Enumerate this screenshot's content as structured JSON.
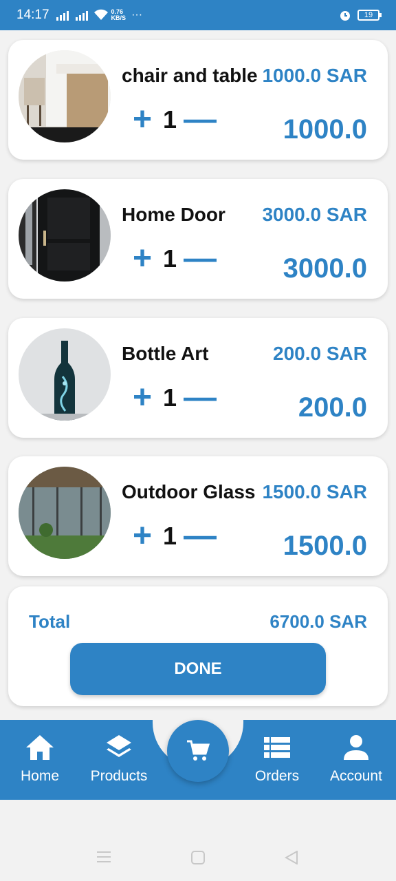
{
  "status_bar": {
    "time": "14:17",
    "speed_value": "0.76",
    "speed_unit": "KB/S",
    "more": "···",
    "battery": "19"
  },
  "cart": {
    "items": [
      {
        "name": "chair and table",
        "price": "1000.0 SAR",
        "quantity": "1",
        "line_total": "1000.0",
        "image_icon": "chair-table-photo"
      },
      {
        "name": "Home Door",
        "price": "3000.0 SAR",
        "quantity": "1",
        "line_total": "3000.0",
        "image_icon": "door-photo"
      },
      {
        "name": "Bottle Art",
        "price": "200.0 SAR",
        "quantity": "1",
        "line_total": "200.0",
        "image_icon": "bottle-photo"
      },
      {
        "name": "Outdoor Glass",
        "price": "1500.0 SAR",
        "quantity": "1",
        "line_total": "1500.0",
        "image_icon": "glass-photo"
      }
    ],
    "increment_symbol": "+",
    "decrement_symbol": "—"
  },
  "summary": {
    "total_label": "Total",
    "total_value": "6700.0 SAR",
    "done_label": "DONE"
  },
  "bottom_nav": {
    "home": "Home",
    "products": "Products",
    "orders": "Orders",
    "account": "Account"
  },
  "colors": {
    "primary": "#2e83c5",
    "background": "#f2f2f2",
    "card": "#ffffff"
  }
}
